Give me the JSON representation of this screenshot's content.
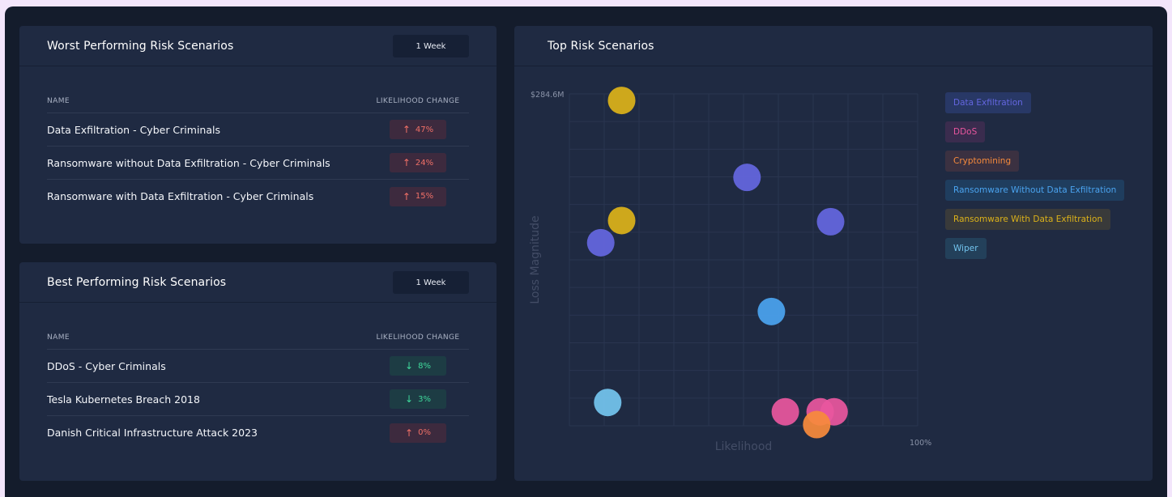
{
  "worst": {
    "title": "Worst Performing Risk Scenarios",
    "period": "1 Week",
    "col_name": "NAME",
    "col_change": "LIKELIHOOD CHANGE",
    "rows": [
      {
        "name": "Data Exfiltration - Cyber Criminals",
        "change": "47%",
        "dir": "up"
      },
      {
        "name": "Ransomware without Data Exfiltration - Cyber Criminals",
        "change": "24%",
        "dir": "up"
      },
      {
        "name": "Ransomware with Data Exfiltration - Cyber Criminals",
        "change": "15%",
        "dir": "up"
      }
    ]
  },
  "best": {
    "title": "Best Performing Risk Scenarios",
    "period": "1 Week",
    "col_name": "NAME",
    "col_change": "LIKELIHOOD CHANGE",
    "rows": [
      {
        "name": "DDoS - Cyber Criminals",
        "change": "8%",
        "dir": "down"
      },
      {
        "name": "Tesla Kubernetes Breach 2018",
        "change": "3%",
        "dir": "down"
      },
      {
        "name": "Danish Critical Infrastructure Attack 2023",
        "change": "0%",
        "dir": "up"
      }
    ]
  },
  "icons": {
    "up": "arrow-up-icon",
    "down": "arrow-down-icon",
    "up_glyph": "↑",
    "down_glyph": "↓"
  },
  "top": {
    "title": "Top Risk Scenarios"
  },
  "colors": {
    "up_text": "#f07067",
    "down_text": "#3fd89b"
  },
  "chart_data": {
    "type": "scatter",
    "title": "Top Risk Scenarios",
    "xlabel": "Likelihood",
    "ylabel": "Loss Magnitude",
    "x_tick_max_label": "100%",
    "y_tick_max_label": "$284.6M",
    "xlim": [
      0,
      100
    ],
    "ylim": [
      0,
      284.6
    ],
    "grid": true,
    "legend_position": "right",
    "series": [
      {
        "name": "Data Exfiltration",
        "color": "#6466e0",
        "bg": "#283866",
        "points": [
          [
            51,
            213
          ],
          [
            75,
            175
          ],
          [
            9,
            157
          ]
        ]
      },
      {
        "name": "DDoS",
        "color": "#e8569e",
        "bg": "#3a2c4e",
        "points": [
          [
            62,
            12
          ],
          [
            72,
            12
          ],
          [
            76,
            12
          ]
        ]
      },
      {
        "name": "Cryptomining",
        "color": "#f68a3c",
        "bg": "#3b3141",
        "points": [
          [
            71,
            1
          ]
        ]
      },
      {
        "name": "Ransomware Without Data Exfiltration",
        "color": "#4aa3ef",
        "bg": "#1f3d5e",
        "points": [
          [
            58,
            98
          ]
        ]
      },
      {
        "name": "Ransomware With Data Exfiltration",
        "color": "#dcb21a",
        "bg": "#393a3a",
        "points": [
          [
            15,
            279
          ],
          [
            15,
            176
          ]
        ]
      },
      {
        "name": "Wiper",
        "color": "#73c4ee",
        "bg": "#23405a",
        "points": [
          [
            11,
            20
          ]
        ]
      }
    ]
  }
}
